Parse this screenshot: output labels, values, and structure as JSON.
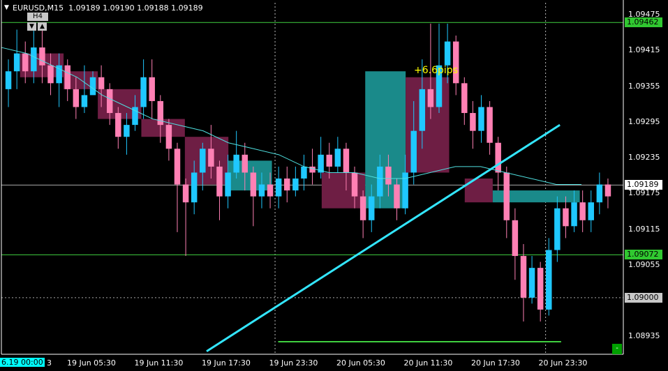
{
  "header": {
    "menu_arrow": "▼",
    "symbol_tf": "EURUSD,M15",
    "ohlc": "1.09189 1.09190 1.09188 1.09189"
  },
  "timeframe_badge": "H4",
  "nav_buttons": {
    "down": "▼",
    "up": "▲"
  },
  "price_axis_labels": [
    "1.09475",
    "1.09415",
    "1.09355",
    "1.09295",
    "1.09235",
    "1.09175",
    "1.09115",
    "1.09055",
    "1.08995",
    "1.08935"
  ],
  "price_badges": [
    {
      "value": "1.09462",
      "style": "green"
    },
    {
      "value": "1.09189",
      "style": "white"
    },
    {
      "value": "1.09072",
      "style": "green"
    },
    {
      "value": "1.09000",
      "style": "grey"
    }
  ],
  "time_labels": [
    "19 Jun 05:30",
    "19 Jun 11:30",
    "19 Jun 17:30",
    "19 Jun 23:30",
    "20 Jun 05:30",
    "20 Jun 11:30",
    "20 Jun 17:30",
    "20 Jun 23:30"
  ],
  "partial_time_label": "3",
  "cursor_time": "6.19 00:00",
  "annotation": "+6.6pips",
  "corner_button": "-",
  "colors": {
    "background": "#000000",
    "bull_candle": "#1fc8ff",
    "bear_candle": "#ff80b4",
    "bull_box": "#1a8a8a",
    "bear_box": "#6e1e44",
    "hline": "#40d040",
    "ma_line": "#4fe0e0",
    "trend_line": "#33e6ff",
    "pips_text": "#ffff00"
  },
  "chart_data": {
    "type": "candlestick",
    "symbol": "EURUSD",
    "timeframe": "M15",
    "ylim": [
      1.08905,
      1.09495
    ],
    "price_ticks": [
      1.09475,
      1.09415,
      1.09355,
      1.09295,
      1.09235,
      1.09175,
      1.09115,
      1.09055,
      1.08995,
      1.08935
    ],
    "horizontal_levels": [
      1.09462,
      1.09072,
      1.08926
    ],
    "current_price": 1.09189,
    "dashed_level": 1.09,
    "candles": [
      [
        1.0935,
        1.0938,
        1.094,
        1.0932
      ],
      [
        1.0938,
        1.0941,
        1.0945,
        1.0935
      ],
      [
        1.0941,
        1.0938,
        1.0943,
        1.0936
      ],
      [
        1.0938,
        1.0942,
        1.0946,
        1.0936
      ],
      [
        1.0942,
        1.0939,
        1.0945,
        1.0936
      ],
      [
        1.0939,
        1.0936,
        1.0941,
        1.0934
      ],
      [
        1.0936,
        1.0939,
        1.0941,
        1.0932
      ],
      [
        1.0939,
        1.0935,
        1.094,
        1.0933
      ],
      [
        1.0935,
        1.0932,
        1.0937,
        1.093
      ],
      [
        1.0932,
        1.0934,
        1.0939,
        1.0931
      ],
      [
        1.0934,
        1.0937,
        1.0938,
        1.0935
      ],
      [
        1.0937,
        1.0935,
        1.0939,
        1.0932
      ],
      [
        1.0935,
        1.0931,
        1.0936,
        1.0929
      ],
      [
        1.0931,
        1.0927,
        1.0932,
        1.0925
      ],
      [
        1.0927,
        1.0929,
        1.0931,
        1.0924
      ],
      [
        1.0929,
        1.0932,
        1.0934,
        1.0928
      ],
      [
        1.0932,
        1.0937,
        1.094,
        1.093
      ],
      [
        1.0937,
        1.0933,
        1.094,
        1.093
      ],
      [
        1.0933,
        1.0929,
        1.0934,
        1.0926
      ],
      [
        1.0929,
        1.0925,
        1.093,
        1.0923
      ],
      [
        1.0925,
        1.0919,
        1.0926,
        1.0911
      ],
      [
        1.0919,
        1.0916,
        1.092,
        1.0907
      ],
      [
        1.0916,
        1.0921,
        1.0923,
        1.0914
      ],
      [
        1.0921,
        1.0925,
        1.0926,
        1.0918
      ],
      [
        1.0925,
        1.0922,
        1.0929,
        1.092
      ],
      [
        1.0922,
        1.0917,
        1.0923,
        1.0913
      ],
      [
        1.0917,
        1.0921,
        1.0924,
        1.0915
      ],
      [
        1.0921,
        1.0924,
        1.0928,
        1.092
      ],
      [
        1.0924,
        1.0921,
        1.0926,
        1.0918
      ],
      [
        1.0921,
        1.0917,
        1.0922,
        1.0912
      ],
      [
        1.0917,
        1.0919,
        1.0921,
        1.0915
      ],
      [
        1.0919,
        1.0917,
        1.0921,
        1.0915
      ],
      [
        1.0917,
        1.092,
        1.0922,
        1.0915
      ],
      [
        1.092,
        1.0918,
        1.0922,
        1.0916
      ],
      [
        1.0918,
        1.092,
        1.0922,
        1.0917
      ],
      [
        1.092,
        1.0922,
        1.0924,
        1.0918
      ],
      [
        1.0922,
        1.0921,
        1.0925,
        1.0919
      ],
      [
        1.0921,
        1.0924,
        1.0927,
        1.092
      ],
      [
        1.0924,
        1.0922,
        1.0926,
        1.092
      ],
      [
        1.0922,
        1.0925,
        1.0927,
        1.0921
      ],
      [
        1.0925,
        1.0921,
        1.0926,
        1.0918
      ],
      [
        1.0921,
        1.0917,
        1.0922,
        1.0915
      ],
      [
        1.0917,
        1.0913,
        1.0918,
        1.091
      ],
      [
        1.0913,
        1.0917,
        1.0919,
        1.0911
      ],
      [
        1.0917,
        1.0922,
        1.0924,
        1.0915
      ],
      [
        1.0922,
        1.0919,
        1.0924,
        1.0917
      ],
      [
        1.0919,
        1.0915,
        1.092,
        1.0913
      ],
      [
        1.0915,
        1.0921,
        1.0924,
        1.0914
      ],
      [
        1.0921,
        1.0928,
        1.0933,
        1.0919
      ],
      [
        1.0928,
        1.0935,
        1.094,
        1.0925
      ],
      [
        1.0935,
        1.0932,
        1.0946,
        1.093
      ],
      [
        1.0932,
        1.0939,
        1.0946,
        1.0931
      ],
      [
        1.0939,
        1.0943,
        1.0946,
        1.0936
      ],
      [
        1.0943,
        1.0936,
        1.0944,
        1.0934
      ],
      [
        1.0936,
        1.0931,
        1.0937,
        1.0929
      ],
      [
        1.0931,
        1.0928,
        1.0933,
        1.0925
      ],
      [
        1.0928,
        1.0932,
        1.0934,
        1.0926
      ],
      [
        1.0932,
        1.0926,
        1.0933,
        1.0924
      ],
      [
        1.0926,
        1.0921,
        1.0927,
        1.0918
      ],
      [
        1.0921,
        1.0913,
        1.0922,
        1.091
      ],
      [
        1.0913,
        1.0907,
        1.0915,
        1.0903
      ],
      [
        1.0907,
        1.09,
        1.0909,
        1.0896
      ],
      [
        1.09,
        1.0905,
        1.0907,
        1.0899
      ],
      [
        1.0905,
        1.0898,
        1.0906,
        1.0896
      ],
      [
        1.0898,
        1.0908,
        1.091,
        1.0897
      ],
      [
        1.0908,
        1.0915,
        1.0917,
        1.0906
      ],
      [
        1.0915,
        1.0912,
        1.0917,
        1.091
      ],
      [
        1.0912,
        1.0916,
        1.0918,
        1.0911
      ],
      [
        1.0916,
        1.0913,
        1.0918,
        1.0911
      ],
      [
        1.0913,
        1.0916,
        1.0918,
        1.0911
      ],
      [
        1.0916,
        1.0919,
        1.0921,
        1.0914
      ],
      [
        1.0919,
        1.0917,
        1.092,
        1.0915
      ]
    ],
    "boxes": [
      {
        "kind": "bear",
        "t_start": 0.03,
        "t_end": 0.1,
        "high": 1.0941,
        "low": 1.0937
      },
      {
        "kind": "bear",
        "t_start": 0.1,
        "t_end": 0.155,
        "high": 1.0938,
        "low": 1.0935
      },
      {
        "kind": "bear",
        "t_start": 0.155,
        "t_end": 0.225,
        "high": 1.0935,
        "low": 1.093
      },
      {
        "kind": "bear",
        "t_start": 0.225,
        "t_end": 0.295,
        "high": 1.093,
        "low": 1.0927
      },
      {
        "kind": "bear",
        "t_start": 0.295,
        "t_end": 0.365,
        "high": 1.0927,
        "low": 1.0919
      },
      {
        "kind": "bull",
        "t_start": 0.365,
        "t_end": 0.435,
        "high": 1.0923,
        "low": 1.0918
      },
      {
        "kind": "bear",
        "t_start": 0.515,
        "t_end": 0.585,
        "high": 1.0921,
        "low": 1.0915
      },
      {
        "kind": "bull",
        "t_start": 0.585,
        "t_end": 0.65,
        "high": 1.0938,
        "low": 1.0915
      },
      {
        "kind": "bear",
        "t_start": 0.65,
        "t_end": 0.72,
        "high": 1.0937,
        "low": 1.0921
      },
      {
        "kind": "bear",
        "t_start": 0.745,
        "t_end": 0.79,
        "high": 1.092,
        "low": 1.0916
      },
      {
        "kind": "bull",
        "t_start": 0.79,
        "t_end": 0.93,
        "high": 1.0918,
        "low": 1.0916
      }
    ],
    "moving_average": [
      1.0942,
      1.0941,
      1.0939,
      1.0937,
      1.0934,
      1.0932,
      1.093,
      1.0929,
      1.0928,
      1.0926,
      1.0925,
      1.0924,
      1.0922,
      1.0921,
      1.0921,
      1.092,
      1.092,
      1.0921,
      1.0922,
      1.0922,
      1.0921,
      1.092,
      1.0919,
      1.0919
    ],
    "trend_line": {
      "start": 1.0891,
      "end": 1.0929
    }
  }
}
